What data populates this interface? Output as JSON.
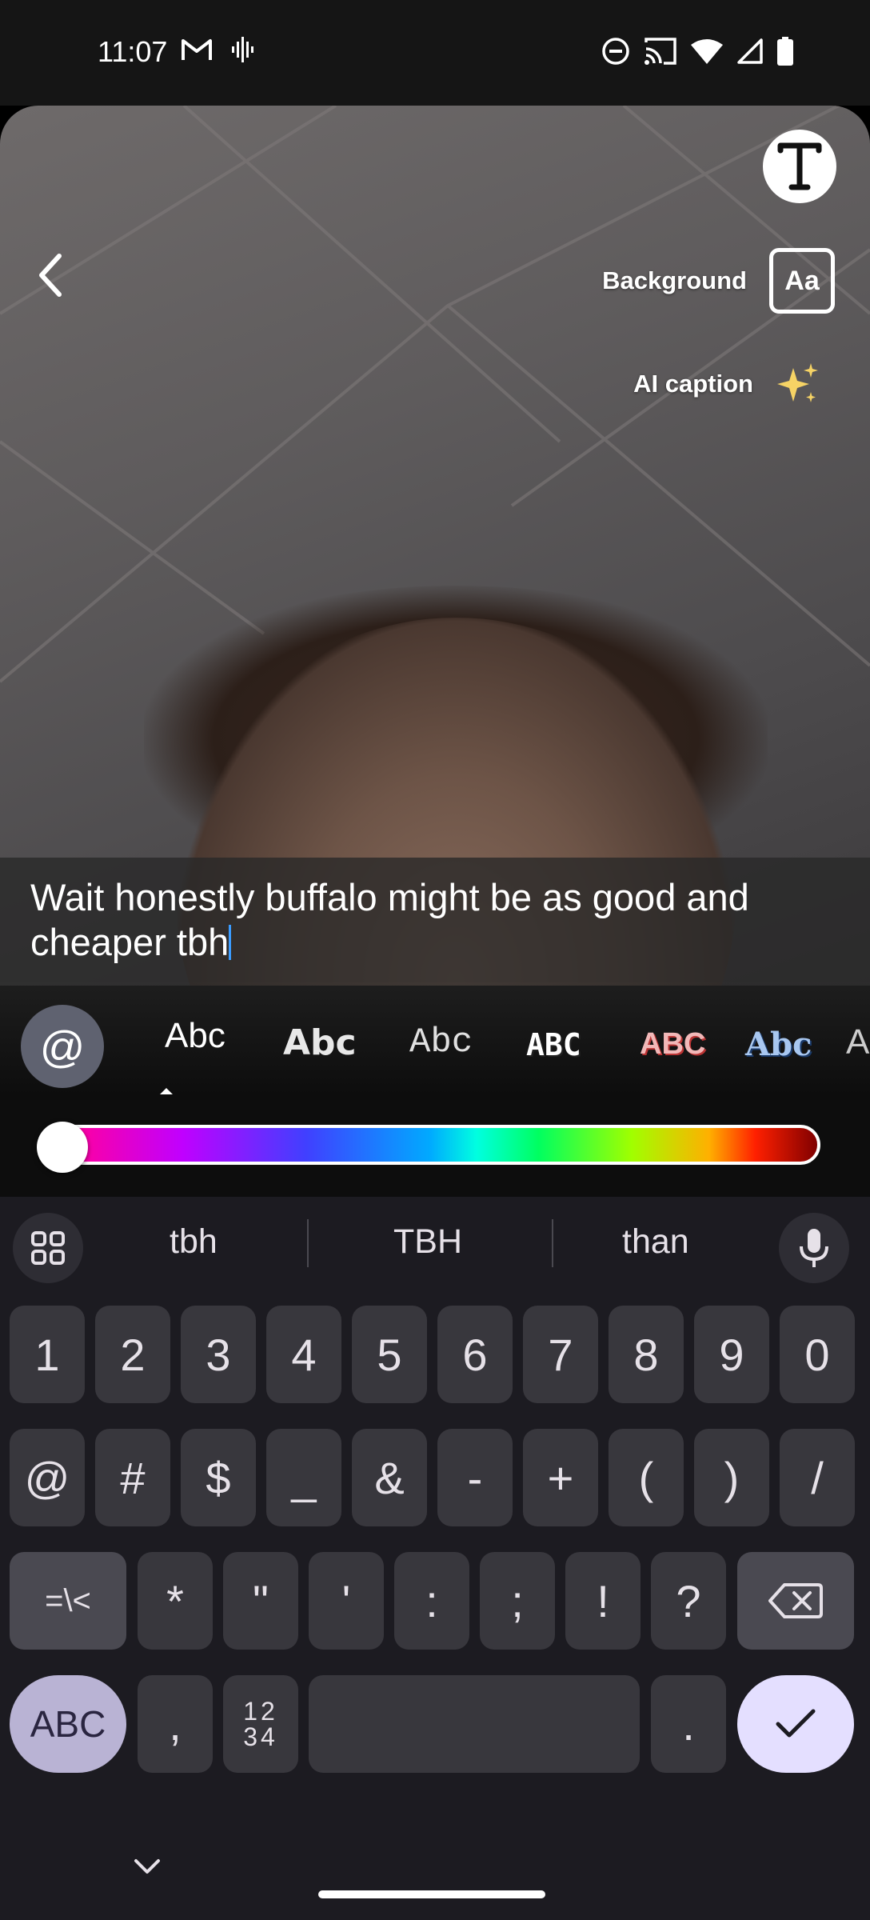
{
  "status_bar": {
    "time": "11:07",
    "left_icons": [
      "gmail-icon",
      "voice-waveform-icon"
    ],
    "right_icons": [
      "do-not-disturb-icon",
      "cast-icon",
      "wifi-icon",
      "cellular-signal-icon",
      "battery-icon"
    ]
  },
  "editor": {
    "background_label": "Background",
    "background_button": "Aa",
    "ai_caption_label": "AI caption",
    "caption_text": "Wait honestly buffalo might be as good and cheaper tbh",
    "mention_symbol": "@"
  },
  "font_styles": [
    "Abc",
    "Abc",
    "Abc",
    "ABC",
    "ABC",
    "Abc",
    "A"
  ],
  "selected_font_index": 0,
  "color_slider": {
    "value": 0.0
  },
  "keyboard": {
    "suggestions": [
      "tbh",
      "TBH",
      "than"
    ],
    "row1": [
      "1",
      "2",
      "3",
      "4",
      "5",
      "6",
      "7",
      "8",
      "9",
      "0"
    ],
    "row2": [
      "@",
      "#",
      "$",
      "_",
      "&",
      "-",
      "+",
      "(",
      ")",
      "/"
    ],
    "row3": [
      "=\\<",
      "*",
      "\"",
      "'",
      ":",
      ";",
      "!",
      "?"
    ],
    "abc_label": "ABC",
    "comma": ",",
    "numpad_top": "12",
    "numpad_bottom": "34",
    "period": "."
  }
}
